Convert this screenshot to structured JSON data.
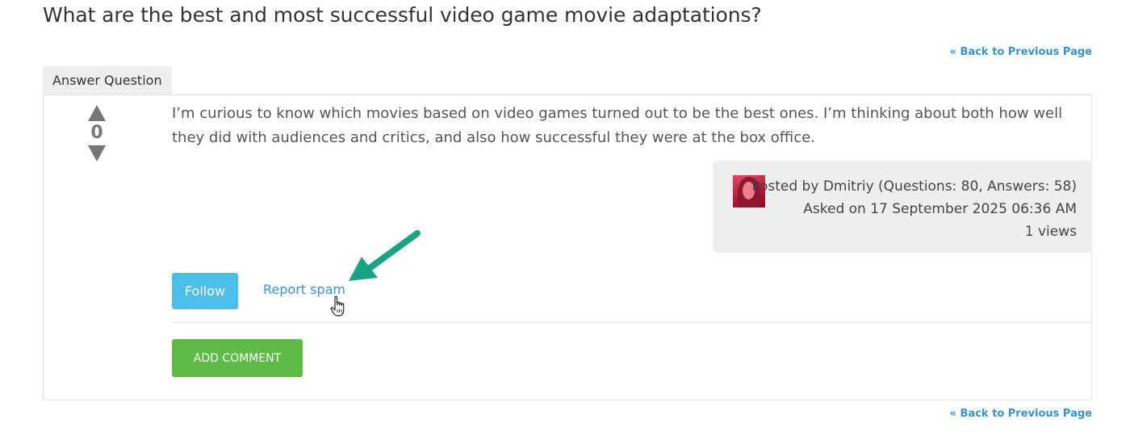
{
  "page": {
    "title": "What are the best and most successful video game movie adaptations?",
    "back_link_top": "« Back to Previous Page",
    "back_link_bottom": "« Back to Previous Page"
  },
  "tabs": {
    "answer_question": "Answer Question"
  },
  "question": {
    "vote_count": "0",
    "vote_up_icon": "triangle-up-icon",
    "vote_down_icon": "triangle-down-icon",
    "body": "I’m curious to know which movies based on video games turned out to be the best ones. I’m thinking about both how well they did with audiences and critics, and also how successful they were at the box office.",
    "posted_by_prefix": "Posted by ",
    "author": "Dmitriy",
    "author_stats": " (Questions: 80, Answers: 58)",
    "asked_on": "Asked on 17 September 2025 06:36 AM",
    "views": "1 views"
  },
  "actions": {
    "follow_label": "Follow",
    "report_spam_label": "Report spam",
    "add_comment_label": "ADD COMMENT"
  },
  "colors": {
    "link": "#3a92d6",
    "follow_button": "#4dbde9",
    "add_comment_button": "#5dbb46",
    "annotation_arrow": "#1aa384",
    "panel_background": "#eeeeee"
  }
}
